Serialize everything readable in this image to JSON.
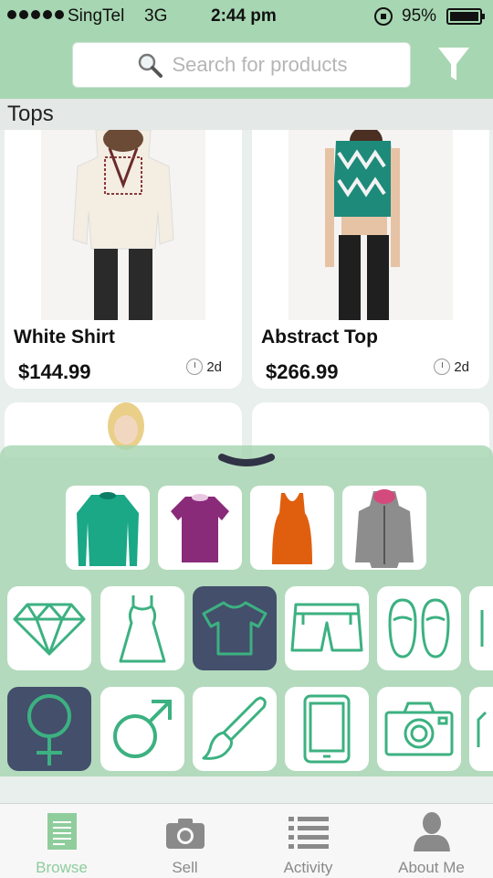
{
  "status_bar": {
    "carrier": "SingTel",
    "network": "3G",
    "time": "2:44 pm",
    "battery": "95%"
  },
  "search": {
    "placeholder": "Search for products",
    "icon": "magnifier-icon"
  },
  "filter": {
    "icon": "funnel-icon"
  },
  "section_title": "Tops",
  "products": [
    {
      "name": "White Shirt",
      "price": "$144.99",
      "age": "2d"
    },
    {
      "name": "Abstract Top",
      "price": "$266.99",
      "age": "2d"
    }
  ],
  "drawer": {
    "handle_icon": "chevron-down-icon",
    "recent_items": [
      "teal-long-sleeve-top",
      "purple-tee",
      "orange-tank-top",
      "grey-hooded-coat"
    ],
    "categories_row1": [
      "diamond-icon",
      "dress-icon",
      "tshirt-icon",
      "shorts-icon",
      "shoes-icon"
    ],
    "categories_row2": [
      "female-icon",
      "male-icon",
      "paintbrush-icon",
      "tablet-icon",
      "camera-icon"
    ],
    "selected_category": "tshirt-icon",
    "selected_gender": "female-icon"
  },
  "tabbar": {
    "tabs": [
      {
        "label": "Browse",
        "icon": "browse-icon",
        "active": true
      },
      {
        "label": "Sell",
        "icon": "camera-icon",
        "active": false
      },
      {
        "label": "Activity",
        "icon": "list-icon",
        "active": false
      },
      {
        "label": "About Me",
        "icon": "person-icon",
        "active": false
      }
    ]
  },
  "colors": {
    "brand_green": "#a7d6b2",
    "icon_green": "#3cb181",
    "selected_navy": "#434f6b"
  }
}
